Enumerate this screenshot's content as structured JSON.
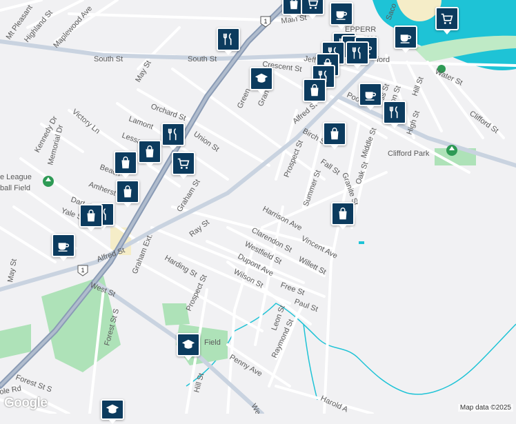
{
  "streets": {
    "main_st": "Main St",
    "south_st_w": "South St",
    "south_st_e": "South St",
    "crescent_st": "Crescent St",
    "jeff": "Jeff",
    "mt_pleasant": "Mt Pleasant",
    "highland_st": "Highland St",
    "maplewood_ave": "Maplewood Ave",
    "may_st_n": "May St",
    "orchard_st": "Orchard St",
    "lamont": "Lamont",
    "lessard": "Lessard",
    "union_st": "Union St",
    "victory_ln": "Victory Ln",
    "kennedy_dr": "Kennedy Dr",
    "memorial_dr": "Memorial Dr",
    "beach": "Beach",
    "amherst": "Amherst",
    "dart": "Dart",
    "yale_st": "Yale St",
    "graham_st": "Graham St",
    "ray_st": "Ray St",
    "alfred_st_w": "Alfred St",
    "alfred_st_e": "Alfred St",
    "graham_ext": "Graham Ext.",
    "harding_st": "Harding St",
    "prospect_st_s": "Prospect St",
    "prospect_st_n": "Prospect St",
    "west_st": "West St",
    "forest_st_s": "Forest St S",
    "forest_st_s2": "Forest St S",
    "hill_st_s": "Hill St",
    "penny_ave": "Penny Ave",
    "may_st_w": "May St",
    "birch_st": "Birch St",
    "fall_st": "Fall St",
    "summer_st": "Summer St",
    "granite_st": "Granite St",
    "oak_st": "Oak St",
    "middle_st": "Middle St",
    "high_st": "High St",
    "hill_st_n": "Hill St",
    "water_st": "Water St",
    "clifford_st": "Clifford St",
    "pool_st": "Pool St",
    "harrison_ave": "Harrison Ave",
    "clarendon_st": "Clarendon St",
    "westfield_st": "Westfield St",
    "vincent_ave": "Vincent Ave",
    "dupont_ave": "Dupont Ave",
    "willett_st": "Willett St",
    "wilson_st": "Wilson St",
    "free_st": "Free St",
    "paul_st": "Paul St",
    "leon_st": "Leon St",
    "raymond_st": "Raymond St",
    "harold_a": "Harold A",
    "green": "Green",
    "gran": "Gran",
    "ole_rd": "ole Rd",
    "we": "We",
    "saco": "Saco",
    "ss_st": "ss St",
    "on_st": "on St",
    "alfred_st_short": "Alfred St"
  },
  "places": {
    "clifford_park": "Clifford Park",
    "league_field_1": "e League",
    "league_field_2": "ball Field",
    "pepperell": "EPPERR",
    "am": "AM",
    "biddeford": "ford",
    "field_s": "S",
    "field": "Field"
  },
  "route_shields": [
    "1",
    "1"
  ],
  "markers": [
    {
      "icon": "shopping-bag-icon"
    },
    {
      "icon": "cart-icon"
    },
    {
      "icon": "coffee-icon"
    },
    {
      "icon": "cart-icon"
    },
    {
      "icon": "restaurant-icon"
    },
    {
      "icon": "coffee-icon"
    },
    {
      "icon": "restaurant-icon"
    },
    {
      "icon": "restaurant-icon"
    },
    {
      "icon": "coffee-icon"
    },
    {
      "icon": "restaurant-icon"
    },
    {
      "icon": "school-icon"
    },
    {
      "icon": "shopping-bag-icon"
    },
    {
      "icon": "restaurant-icon"
    },
    {
      "icon": "restaurant-icon"
    },
    {
      "icon": "shopping-bag-icon"
    },
    {
      "icon": "coffee-icon"
    },
    {
      "icon": "restaurant-icon"
    },
    {
      "icon": "shopping-bag-icon"
    },
    {
      "icon": "restaurant-icon"
    },
    {
      "icon": "shopping-bag-icon"
    },
    {
      "icon": "cart-icon"
    },
    {
      "icon": "shopping-bag-icon"
    },
    {
      "icon": "shopping-bag-icon"
    },
    {
      "icon": "restaurant-icon"
    },
    {
      "icon": "shopping-bag-icon"
    },
    {
      "icon": "coffee-icon"
    },
    {
      "icon": "shopping-bag-icon"
    },
    {
      "icon": "school-icon"
    },
    {
      "icon": "school-icon"
    }
  ],
  "attribution": "Map data ©2025",
  "logo": "Google",
  "colors": {
    "background": "#f1f1f3",
    "road": "#ffffff",
    "highway": "#8a9bb5",
    "arterial": "#c9d3e0",
    "water": "#1ec3d6",
    "park": "#aee2b8",
    "sand": "#f5edc8",
    "marker": "#0c3b5e"
  }
}
